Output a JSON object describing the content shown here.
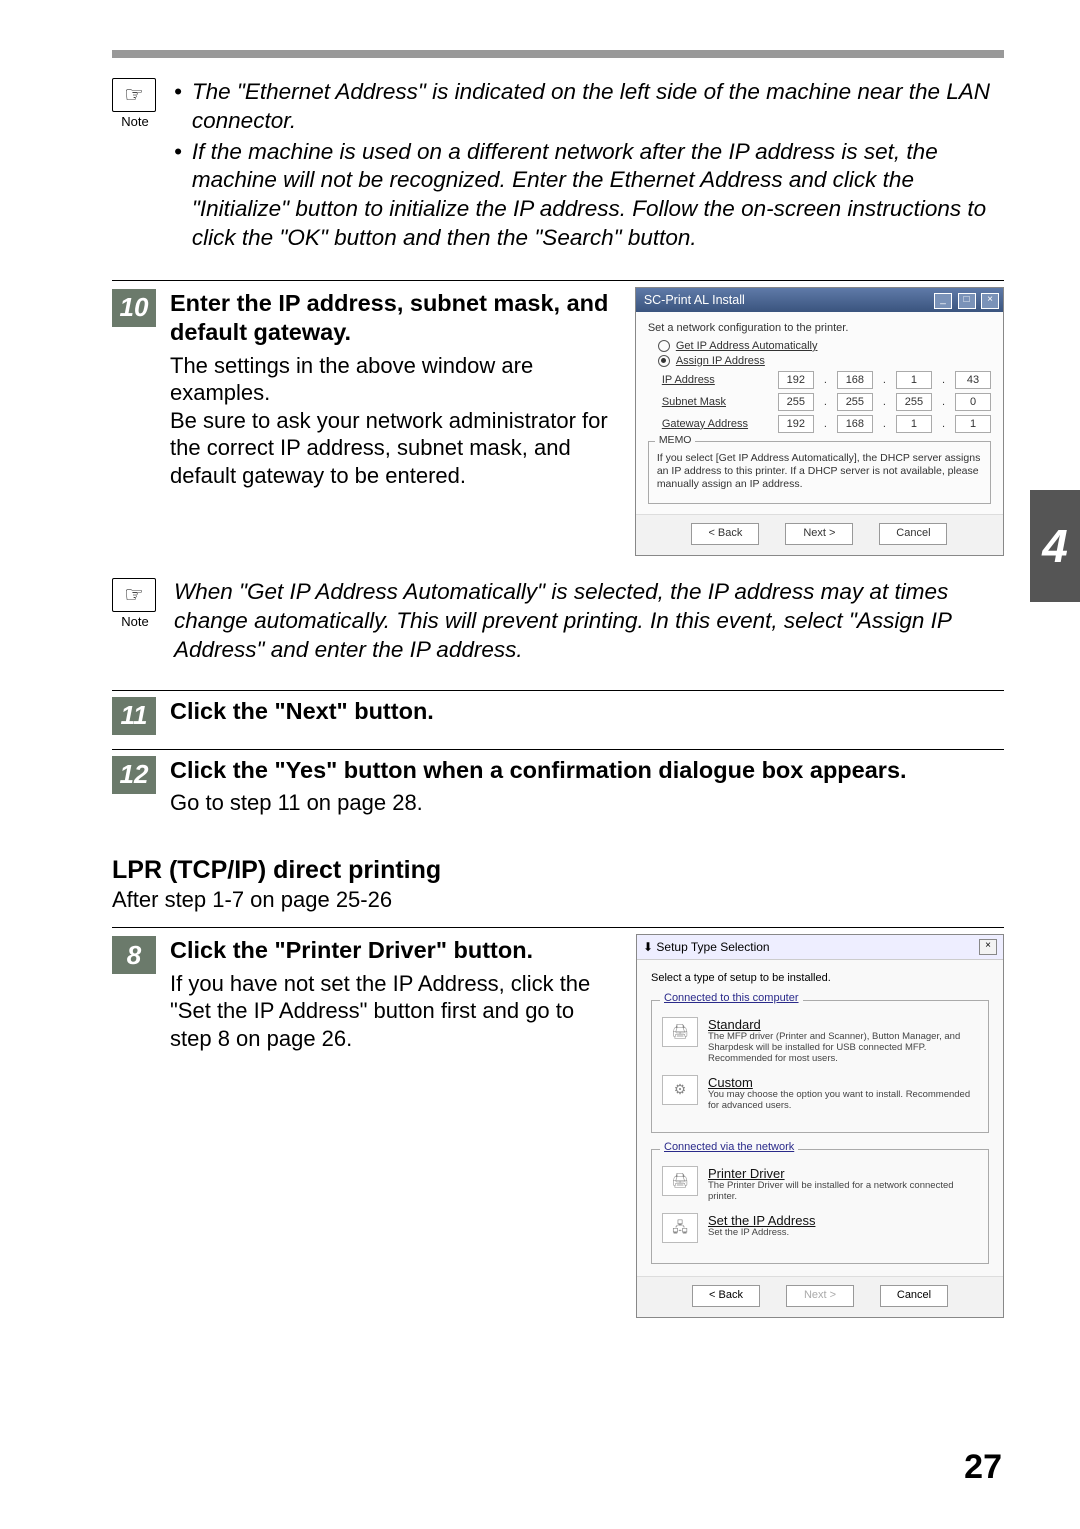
{
  "notes": {
    "label": "Note",
    "icon_glyph": "☞",
    "top": {
      "bullet1": "The \"Ethernet Address\" is indicated on the left side of the machine near the LAN connector.",
      "bullet2": "If the machine is used on a different network after the IP address is set, the machine will not be recognized. Enter the Ethernet Address and click the \"Initialize\" button to initialize the IP address. Follow the on-screen instructions to click the \"OK\" button and then the \"Search\" button."
    },
    "mid": "When \"Get IP Address Automatically\" is selected, the IP address may at times change automatically. This will prevent printing. In this event, select \"Assign IP Address\" and enter the IP address."
  },
  "steps": {
    "s10": {
      "num": "10",
      "title": "Enter the IP address, subnet mask, and default gateway.",
      "p1": "The settings in the above window are examples.",
      "p2": "Be sure to ask your network administrator for the correct IP address, subnet mask, and default gateway to be entered."
    },
    "s11": {
      "num": "11",
      "title": "Click the \"Next\" button."
    },
    "s12": {
      "num": "12",
      "title": "Click the \"Yes\" button when a confirmation dialogue box appears.",
      "p1": "Go to step 11 on page 28."
    },
    "s8": {
      "num": "8",
      "title": "Click the \"Printer Driver\" button.",
      "p1": "If you have not set the IP Address, click the \"Set the IP Address\" button first and go to step 8 on page 26."
    }
  },
  "section": {
    "heading": "LPR (TCP/IP) direct printing",
    "sub": "After step 1-7 on page 25-26"
  },
  "dialog1": {
    "title": "SC-Print AL Install",
    "instr": "Set a network configuration to the printer.",
    "radio_auto": "Get IP Address Automatically",
    "radio_assign": "Assign IP Address",
    "rows": {
      "ip": {
        "label": "IP Address",
        "o": [
          "192",
          "168",
          "1",
          "43"
        ]
      },
      "subnet": {
        "label": "Subnet Mask",
        "o": [
          "255",
          "255",
          "255",
          "0"
        ]
      },
      "gw": {
        "label": "Gateway Address",
        "o": [
          "192",
          "168",
          "1",
          "1"
        ]
      }
    },
    "memo_label": "MEMO",
    "memo": "If you select [Get IP Address Automatically], the DHCP server assigns an IP address to this printer. If a DHCP server is not available, please manually assign an IP address.",
    "btn_back": "< Back",
    "btn_next": "Next >",
    "btn_cancel": "Cancel"
  },
  "dialog2": {
    "title": "Setup Type Selection",
    "instr": "Select a type of setup to be installed.",
    "group1": "Connected to this computer",
    "opt_std": {
      "name": "Standard",
      "desc": "The MFP driver (Printer and Scanner), Button Manager, and Sharpdesk will be installed for USB connected MFP. Recommended for most users."
    },
    "opt_custom": {
      "name": "Custom",
      "desc": "You may choose the option you want to install. Recommended for advanced users."
    },
    "group2": "Connected via the network",
    "opt_prn": {
      "name": "Printer Driver",
      "desc": "The Printer Driver will be installed for a network connected printer."
    },
    "opt_ip": {
      "name": "Set the IP Address",
      "desc": "Set the IP Address."
    },
    "btn_back": "< Back",
    "btn_next": "Next >",
    "btn_cancel": "Cancel"
  },
  "thumb_tab": "4",
  "page_number": "27"
}
